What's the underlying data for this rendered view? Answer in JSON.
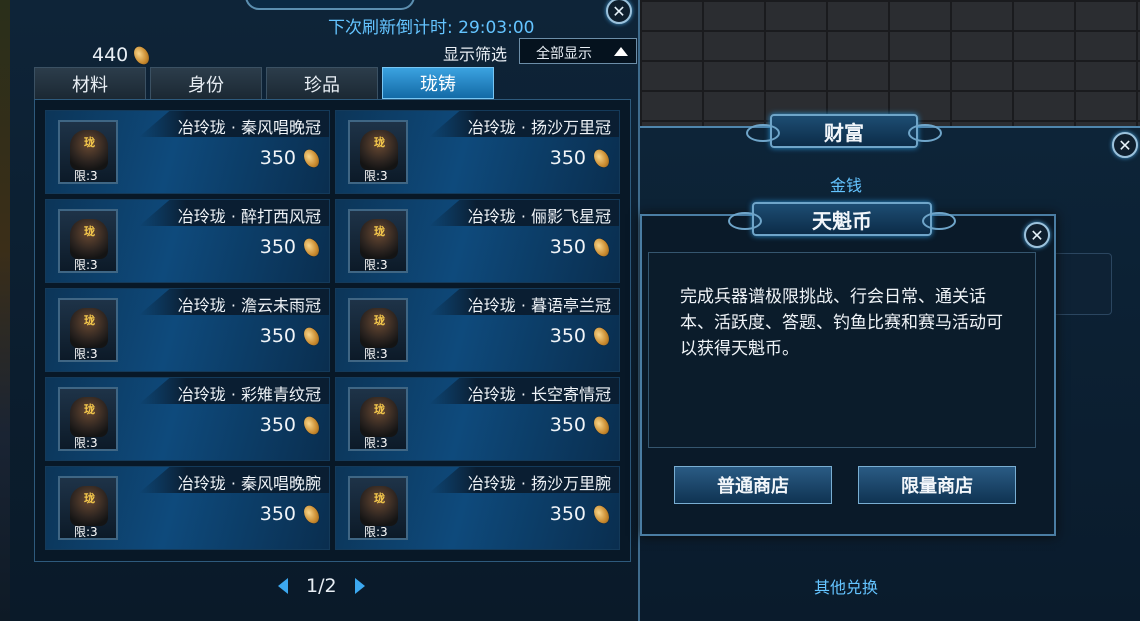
{
  "shop": {
    "refresh_countdown": "下次刷新倒计时: 29:03:00",
    "currency_amount": "440",
    "filter_label": "显示筛选",
    "filter_value": "全部显示",
    "close_label": "✕",
    "tabs": [
      {
        "label": "材料",
        "active": false
      },
      {
        "label": "身份",
        "active": false
      },
      {
        "label": "珍品",
        "active": false
      },
      {
        "label": "珑铸",
        "active": true
      }
    ],
    "items": [
      {
        "name": "冶玲珑 · 秦风唱晚冠",
        "price": "350",
        "limit": "限:3",
        "glyph": "珑"
      },
      {
        "name": "冶玲珑 · 扬沙万里冠",
        "price": "350",
        "limit": "限:3",
        "glyph": "珑"
      },
      {
        "name": "冶玲珑 · 醉打西风冠",
        "price": "350",
        "limit": "限:3",
        "glyph": "珑"
      },
      {
        "name": "冶玲珑 · 俪影飞星冠",
        "price": "350",
        "limit": "限:3",
        "glyph": "珑"
      },
      {
        "name": "冶玲珑 · 澹云未雨冠",
        "price": "350",
        "limit": "限:3",
        "glyph": "珑"
      },
      {
        "name": "冶玲珑 · 暮语亭兰冠",
        "price": "350",
        "limit": "限:3",
        "glyph": "珑"
      },
      {
        "name": "冶玲珑 · 彩雉青纹冠",
        "price": "350",
        "limit": "限:3",
        "glyph": "珑"
      },
      {
        "name": "冶玲珑 · 长空寄情冠",
        "price": "350",
        "limit": "限:3",
        "glyph": "珑"
      },
      {
        "name": "冶玲珑 · 秦风唱晚腕",
        "price": "350",
        "limit": "限:3",
        "glyph": "珑"
      },
      {
        "name": "冶玲珑 · 扬沙万里腕",
        "price": "350",
        "limit": "限:3",
        "glyph": "珑"
      }
    ],
    "page_indicator": "1/2"
  },
  "wealth": {
    "title": "财富",
    "subtitle": "金钱",
    "other": "其他兑换",
    "close_label": "✕"
  },
  "coin_popup": {
    "title": "天魁币",
    "description": "完成兵器谱极限挑战、行会日常、通关话本、活跃度、答题、钓鱼比赛和赛马活动可以获得天魁币。",
    "normal_shop_label": "普通商店",
    "limited_shop_label": "限量商店",
    "close_label": "✕"
  },
  "colors": {
    "accent_blue": "#64c4ff",
    "tab_active": "#3ba2e0",
    "panel_bg": "#0b1d2e"
  }
}
